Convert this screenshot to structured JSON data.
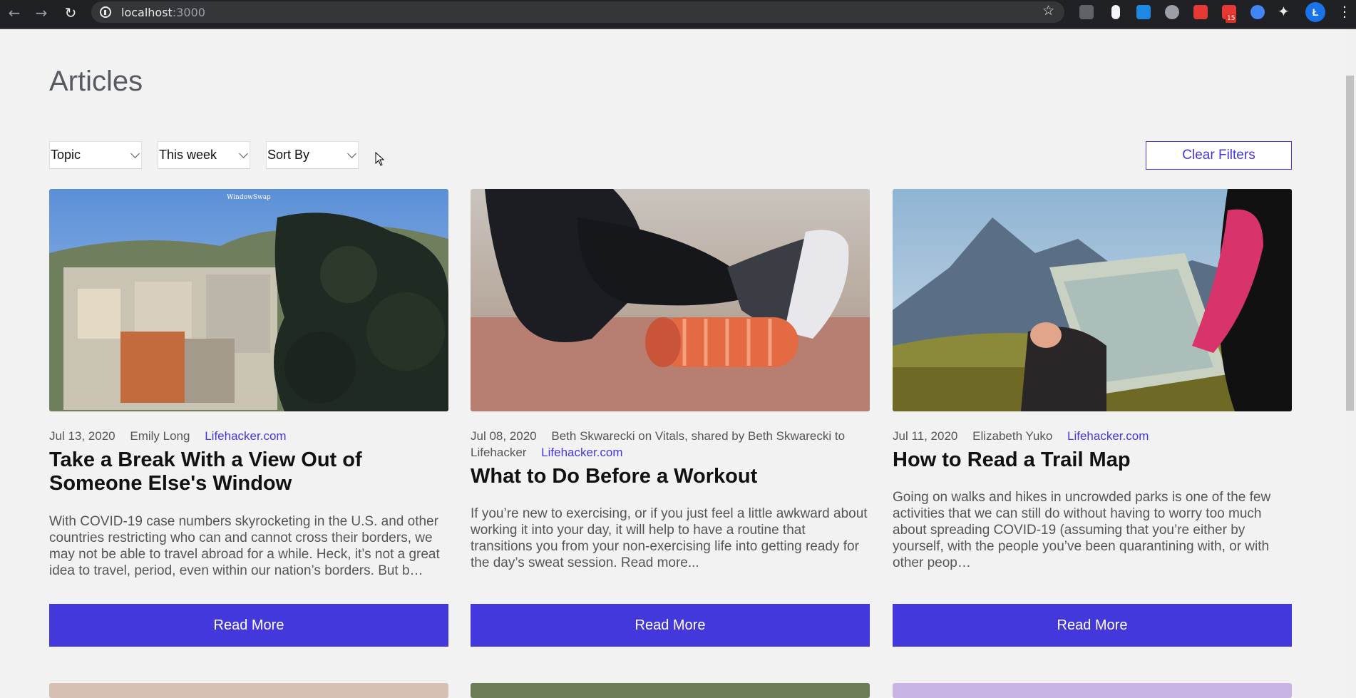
{
  "browser": {
    "url_host": "localhost",
    "url_port": ":3000",
    "extension_badge": "15",
    "profile_initial": "Ł"
  },
  "page": {
    "title": "Articles"
  },
  "filters": {
    "topic": "Topic",
    "period": "This week",
    "sort": "Sort By",
    "clear_label": "Clear Filters"
  },
  "articles": [
    {
      "date": "Jul 13, 2020",
      "author": "Emily Long",
      "source": "Lifehacker.com",
      "title": "Take a Break With a View Out of Someone Else's Window",
      "description": "With COVID-19 case numbers skyrocketing in the U.S. and other countries restricting who can and cannot cross their borders, we may not be able to travel abroad for a while. Heck, it’s not a great idea to travel, period, even within our nation’s borders. But b…",
      "button": "Read More"
    },
    {
      "date": "Jul 08, 2020",
      "author": "Beth Skwarecki on Vitals, shared by Beth Skwarecki to Lifehacker",
      "source": "Lifehacker.com",
      "title": "What to Do Before a Workout",
      "description": "If you’re new to exercising, or if you just feel a little awkward about working it into your day, it will help to have a routine that transitions you from your non-exercising life into getting ready for the day’s sweat session. Read more...",
      "button": "Read More"
    },
    {
      "date": "Jul 11, 2020",
      "author": "Elizabeth Yuko",
      "source": "Lifehacker.com",
      "title": "How to Read a Trail Map",
      "description": "Going on walks and hikes in uncrowded parks is one of the few activities that we can still do without having to worry too much about spreading COVID-19 (assuming that you’re either by yourself, with the people you’ve been quarantining with, or with other peop…",
      "button": "Read More"
    }
  ],
  "image_text": {
    "window_logo": "WindowSwap"
  }
}
